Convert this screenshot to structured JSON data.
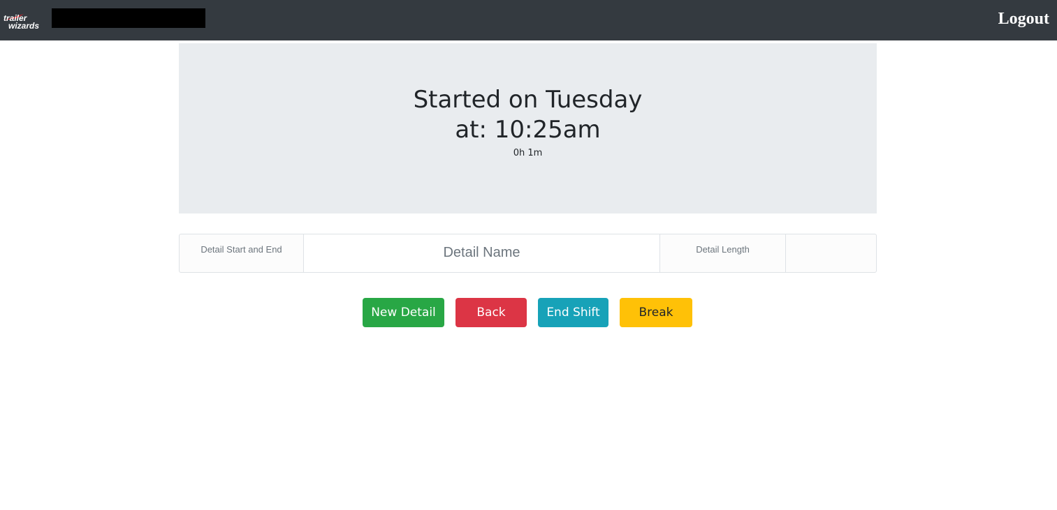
{
  "navbar": {
    "logo_text": "trailer wizards",
    "logout_label": "Logout"
  },
  "shift": {
    "started_line1": "Started on Tuesday",
    "started_line2": "at: 10:25am",
    "duration": "0h 1m"
  },
  "detail_table": {
    "col_start_end": "Detail Start and End",
    "col_name": "Detail Name",
    "col_length": "Detail Length",
    "col_empty": ""
  },
  "actions": {
    "new_detail": "New Detail",
    "back": "Back",
    "end_shift": "End Shift",
    "break": "Break"
  },
  "colors": {
    "navbar": "#343a40",
    "jumbotron": "#e9ecef",
    "success": "#28a745",
    "danger": "#dc3545",
    "info": "#17a2b8",
    "warning": "#ffc107"
  }
}
